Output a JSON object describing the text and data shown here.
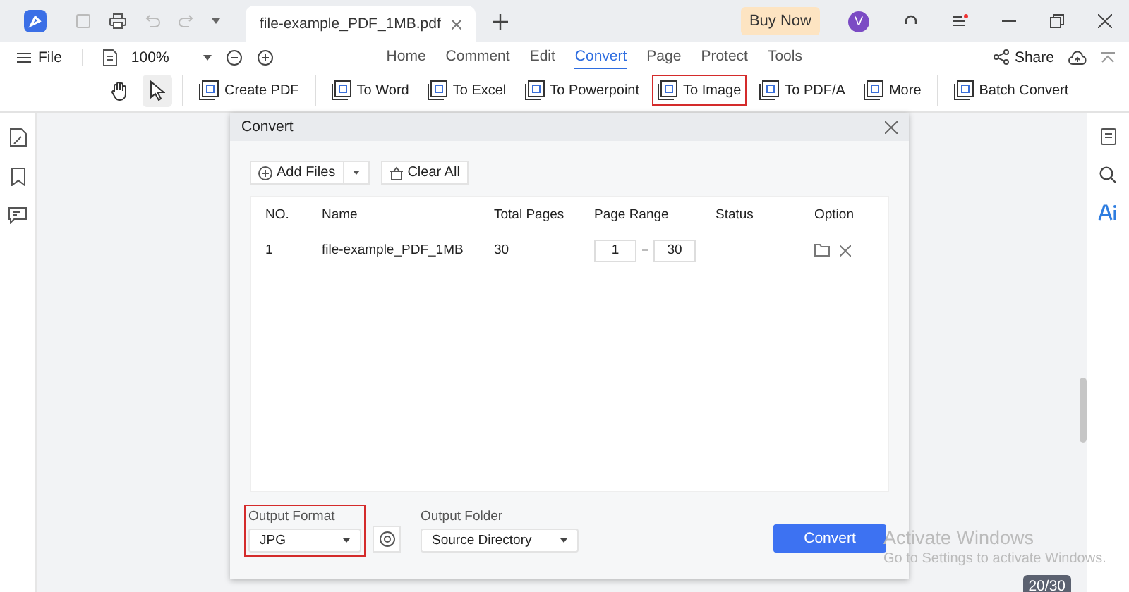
{
  "title_bar": {
    "document_tab": "file-example_PDF_1MB.pdf",
    "buy_button": "Buy Now",
    "avatar": "V"
  },
  "menu_bar": {
    "file": "File",
    "zoom": "100%",
    "share": "Share",
    "tabs": [
      {
        "label": "Home",
        "selected": false
      },
      {
        "label": "Comment",
        "selected": false
      },
      {
        "label": "Edit",
        "selected": false
      },
      {
        "label": "Convert",
        "selected": true
      },
      {
        "label": "Page",
        "selected": false
      },
      {
        "label": "Protect",
        "selected": false
      },
      {
        "label": "Tools",
        "selected": false
      }
    ]
  },
  "toolbar": [
    {
      "label": "Create PDF",
      "highlighted": false
    },
    {
      "label": "To Word",
      "highlighted": false
    },
    {
      "label": "To Excel",
      "highlighted": false
    },
    {
      "label": "To Powerpoint",
      "highlighted": false
    },
    {
      "label": "To Image",
      "highlighted": true
    },
    {
      "label": "To PDF/A",
      "highlighted": false
    },
    {
      "label": "More",
      "highlighted": false
    },
    {
      "label": "Batch Convert",
      "highlighted": false
    }
  ],
  "dialog": {
    "title": "Convert",
    "add_files": "Add Files",
    "clear_all": "Clear All",
    "table": {
      "columns": [
        "NO.",
        "Name",
        "Total Pages",
        "Page Range",
        "Status",
        "Option"
      ],
      "rows": [
        {
          "no": "1",
          "name": "file-example_PDF_1MB",
          "total_pages": "30",
          "range_from": "1",
          "range_to": "30"
        }
      ]
    },
    "output_format": {
      "label": "Output Format",
      "value": "JPG",
      "highlighted": true
    },
    "output_folder": {
      "label": "Output Folder",
      "value": "Source Directory"
    },
    "convert_button": "Convert"
  },
  "page_counter": "20/30",
  "os_notice": {
    "title": "Activate Windows",
    "subtitle": "Go to Settings to activate Windows."
  }
}
